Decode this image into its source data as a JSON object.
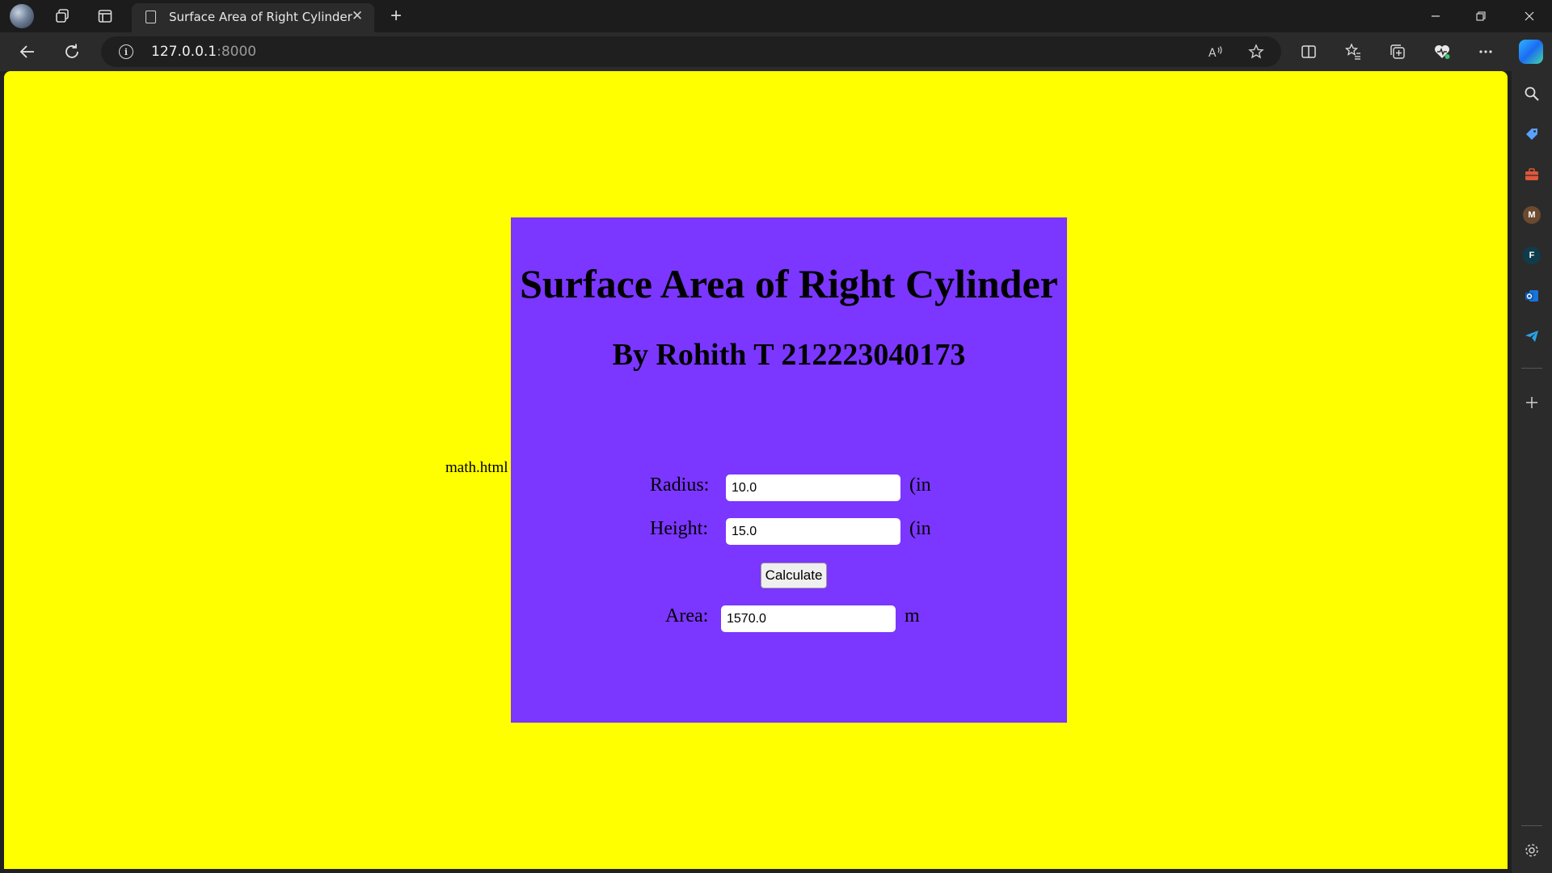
{
  "browser": {
    "tab_title": "Surface Area of Right Cylinder",
    "url_host": "127.0.0.1",
    "url_port": ":8000",
    "new_tab_label": "+",
    "close_tab_label": "✕"
  },
  "page": {
    "broken_image_alt": "math.html",
    "title": "Surface Area of Right Cylinder",
    "subtitle": "By Rohith T 212223040173",
    "radius_label": "Radius:",
    "radius_value": "10.0",
    "radius_unit": "(in",
    "height_label": "Height:",
    "height_value": "15.0",
    "height_unit": "(in",
    "calculate_label": "Calculate",
    "area_label": "Area:",
    "area_value": "1570.0",
    "area_unit": "m"
  },
  "colors": {
    "page_background": "#ffff00",
    "card_background": "#7b36ff"
  }
}
